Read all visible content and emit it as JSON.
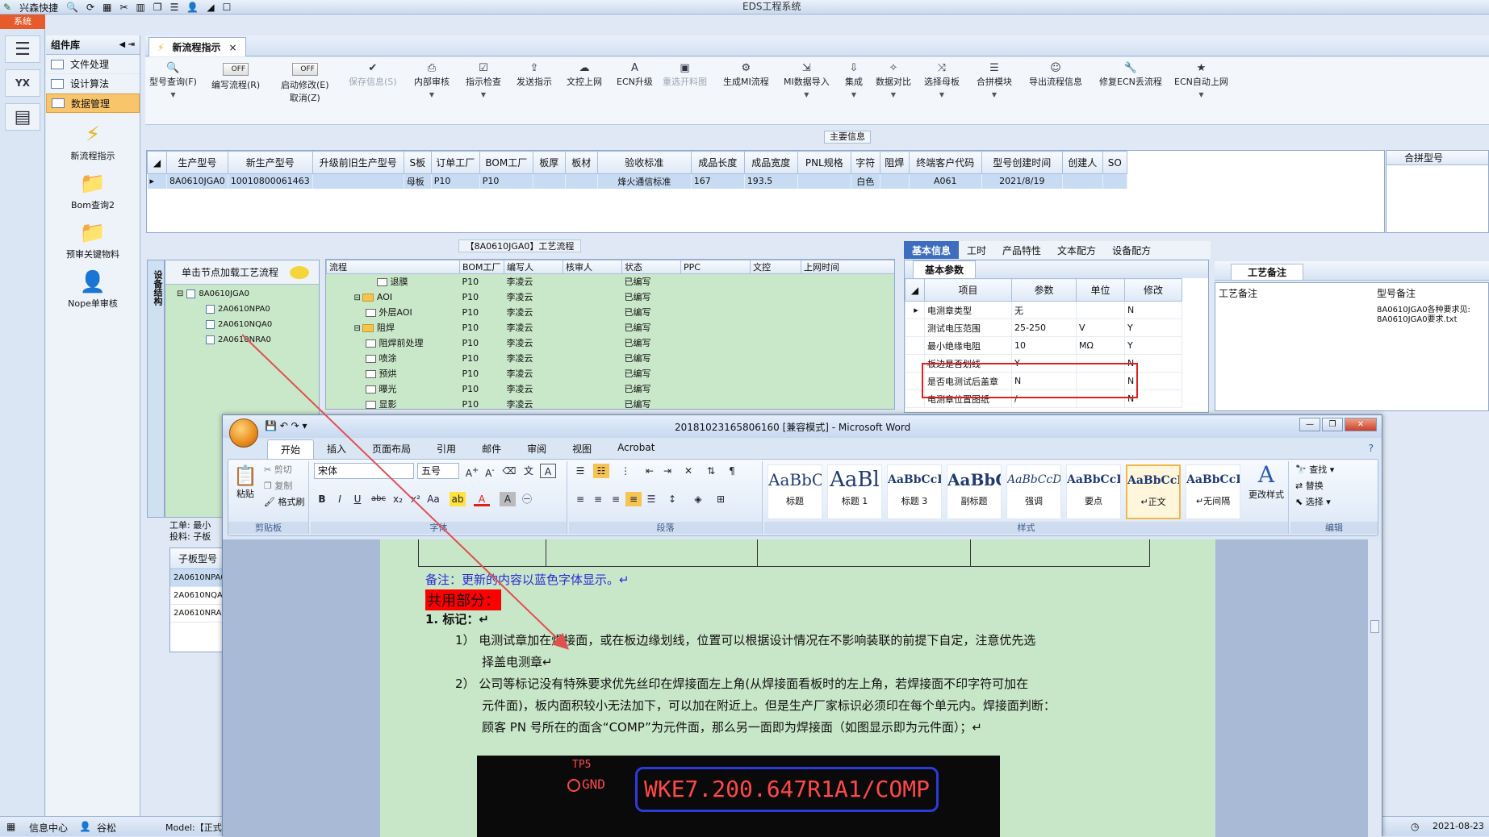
{
  "app": {
    "quick_label": "兴森快捷",
    "title": "EDS工程系统",
    "sys_button": "系统"
  },
  "components": {
    "title": "组件库",
    "items": [
      {
        "label": "文件处理"
      },
      {
        "label": "设计算法"
      },
      {
        "label": "数据管理"
      }
    ],
    "tools": [
      {
        "label": "新流程指示"
      },
      {
        "label": "Bom查询2"
      },
      {
        "label": "预审关键物料"
      },
      {
        "label": "Nope单审核"
      }
    ]
  },
  "tab": {
    "label": "新流程指示",
    "close": "×"
  },
  "ribbon": {
    "buttons": [
      {
        "label": "型号查询(F)"
      },
      {
        "label": "编写流程(R)",
        "toggle": "OFF"
      },
      {
        "label": "启动修改(E)",
        "sub": "取消(Z)",
        "toggle": "OFF"
      },
      {
        "label": "保存信息(S)"
      },
      {
        "label": "内部审核"
      },
      {
        "label": "指示检查"
      },
      {
        "label": "发送指示"
      },
      {
        "label": "文控上网"
      },
      {
        "label": "ECN升级"
      },
      {
        "label": "重选开料图"
      },
      {
        "label": "生成MI流程"
      },
      {
        "label": "MI数据导入"
      },
      {
        "label": "集成"
      },
      {
        "label": "数据对比"
      },
      {
        "label": "选择母板"
      },
      {
        "label": "合拼模块"
      },
      {
        "label": "导出流程信息"
      },
      {
        "label": "修复ECN丢流程"
      },
      {
        "label": "ECN自动上网"
      }
    ]
  },
  "main_info": {
    "label": "主要信息"
  },
  "top_grid": {
    "headers": [
      "生产型号",
      "新生产型号",
      "升级前旧生产型号",
      "S板",
      "订单工厂",
      "BOM工厂",
      "板厚",
      "板材",
      "验收标准",
      "成品长度",
      "成品宽度",
      "PNL规格",
      "字符",
      "阻焊",
      "终端客户代码",
      "型号创建时间",
      "创建人",
      "SO"
    ],
    "row": [
      "8A0610JGA0",
      "10010800061463",
      "",
      "母板",
      "P10",
      "P10",
      "",
      "",
      "烽火通信标准",
      "167",
      "193.5",
      "",
      "白色",
      "",
      "A061",
      "2021/8/19",
      "",
      ""
    ]
  },
  "merge_panel": {
    "title": "合拼型号"
  },
  "process": {
    "label": "【8A0610JGA0】工艺流程"
  },
  "sidebar_struct": {
    "label": "设备结构"
  },
  "tree": {
    "hint": "单击节点加载工艺流程",
    "nodes": [
      {
        "label": "8A0610JGA0"
      },
      {
        "label": "2A0610NPA0"
      },
      {
        "label": "2A0610NQA0"
      },
      {
        "label": "2A0610NRA0"
      }
    ]
  },
  "proc_table": {
    "headers": [
      "流程",
      "BOM工厂",
      "编写人",
      "核审人",
      "状态",
      "PPC",
      "文控",
      "上网时间"
    ],
    "rows": [
      {
        "name": "退膜",
        "factory": "P10",
        "author": "李凌云",
        "status": "已编写",
        "kind": "file",
        "indent": 3
      },
      {
        "name": "AOI",
        "factory": "P10",
        "author": "李凌云",
        "status": "已编写",
        "kind": "folder",
        "indent": 1
      },
      {
        "name": "外层AOI",
        "factory": "P10",
        "author": "李凌云",
        "status": "已编写",
        "kind": "file",
        "indent": 2
      },
      {
        "name": "阻焊",
        "factory": "P10",
        "author": "李凌云",
        "status": "已编写",
        "kind": "folder",
        "indent": 1
      },
      {
        "name": "阻焊前处理",
        "factory": "P10",
        "author": "李凌云",
        "status": "已编写",
        "kind": "file",
        "indent": 2
      },
      {
        "name": "喷涂",
        "factory": "P10",
        "author": "李凌云",
        "status": "已编写",
        "kind": "file",
        "indent": 2
      },
      {
        "name": "预烘",
        "factory": "P10",
        "author": "李凌云",
        "status": "已编写",
        "kind": "file",
        "indent": 2
      },
      {
        "name": "曝光",
        "factory": "P10",
        "author": "李凌云",
        "status": "已编写",
        "kind": "file",
        "indent": 2
      },
      {
        "name": "显影",
        "factory": "P10",
        "author": "李凌云",
        "status": "已编写",
        "kind": "file",
        "indent": 2
      }
    ]
  },
  "right_tabs": [
    {
      "label": "基本信息"
    },
    {
      "label": "工时"
    },
    {
      "label": "产品特性"
    },
    {
      "label": "文本配方"
    },
    {
      "label": "设备配方"
    }
  ],
  "basic": {
    "caption": "基本参数",
    "headers": [
      "项目",
      "参数",
      "单位",
      "修改"
    ],
    "rows": [
      {
        "item": "电测章类型",
        "param": "无",
        "unit": "",
        "mod": "N"
      },
      {
        "item": "测试电压范围",
        "param": "25-250",
        "unit": "V",
        "mod": "Y"
      },
      {
        "item": "最小绝缘电阻",
        "param": "10",
        "unit": "MΩ",
        "mod": "Y"
      },
      {
        "item": "板边是否划线",
        "param": "Y",
        "unit": "",
        "mod": "N"
      },
      {
        "item": "是否电测试后盖章",
        "param": "N",
        "unit": "",
        "mod": "N"
      },
      {
        "item": "电测章位置图纸",
        "param": "/",
        "unit": "",
        "mod": "N"
      }
    ]
  },
  "craft": {
    "title": "工艺备注",
    "col1": "工艺备注",
    "col2": "型号备注",
    "note": "8A0610JGA0各种要求见: 8A0610JGA0要求.txt"
  },
  "low": {
    "line1": "工单: 最小",
    "line2": "投料: 子板"
  },
  "sub_table": {
    "header": "子板型号",
    "rows": [
      "2A0610NPA0",
      "2A0610NQA0",
      "2A0610NRA0"
    ]
  },
  "status": {
    "info": "信息中心",
    "user": "谷松",
    "model": "Model:【正式",
    "date": "2021-08-23"
  },
  "word": {
    "title": "20181023165806160 [兼容模式] - Microsoft Word",
    "tabs": [
      "开始",
      "插入",
      "页面布局",
      "引用",
      "邮件",
      "审阅",
      "视图",
      "Acrobat"
    ],
    "clipboard": {
      "paste": "粘贴",
      "cut": "剪切",
      "copy": "复制",
      "format": "格式刷",
      "label": "剪贴板"
    },
    "font": {
      "name": "宋体",
      "size": "五号",
      "label": "字体"
    },
    "paragraph": {
      "label": "段落"
    },
    "styles": {
      "label": "样式",
      "items": [
        {
          "preview": "AaBbC",
          "name": "标题"
        },
        {
          "preview": "AaBl",
          "name": "标题 1"
        },
        {
          "preview": "AaBbCcD",
          "name": "标题 3"
        },
        {
          "preview": "AaBbC",
          "name": "副标题"
        },
        {
          "preview": "AaBbCcDc",
          "name": "强调"
        },
        {
          "preview": "AaBbCcD",
          "name": "要点"
        },
        {
          "preview": "AaBbCcD",
          "name": "↵正文"
        },
        {
          "preview": "AaBbCcD",
          "name": "↵无间隔"
        }
      ],
      "change": "更改样式"
    },
    "editing": {
      "find": "查找",
      "replace": "替换",
      "select": "选择",
      "label": "编辑"
    },
    "doc": {
      "note": "备注：更新的内容以蓝色字体显示。↵",
      "common": "共用部分：",
      "h1": "1.   标记：↵",
      "p1a": "1）  电测试章加在焊接面，或在板边缘划线，位置可以根据设计情况在不影响装联的前提下自定，注意优先选",
      "p1b": "择盖电测章↵",
      "p2a": "2）  公司等标记没有特殊要求优先丝印在焊接面左上角(从焊接面看板时的左上角，若焊接面不印字符可加在",
      "p2b": "元件面)，板内面积较小无法加下，可以加在附近上。但是生产厂家标识必须印在每个单元内。焊接面判断：",
      "p2c": "顾客 PN 号所在的面含“COMP”为元件面，那么另一面即为焊接面（如图显示即为元件面）；↵",
      "pcb_tp": "TP5",
      "pcb_gnd": "GND",
      "pcb_text": "WKE7.200.647R1A1/COMP"
    }
  }
}
